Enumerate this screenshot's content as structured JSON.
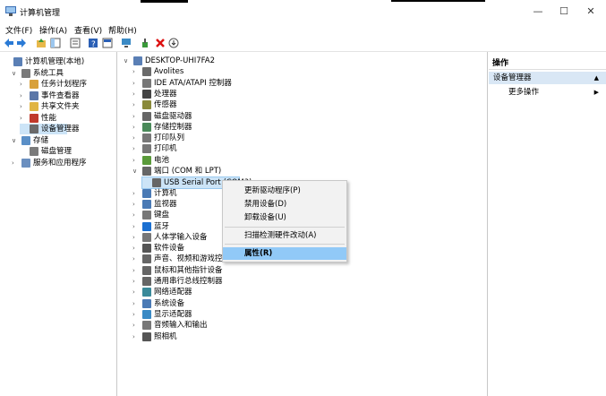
{
  "window": {
    "title": "计算机管理",
    "min": "—",
    "max": "☐",
    "close": "✕"
  },
  "menu": [
    "文件(F)",
    "操作(A)",
    "查看(V)",
    "帮助(H)"
  ],
  "left_tree": [
    {
      "label": "计算机管理(本地)",
      "arrow": "",
      "indent": 0,
      "icon_color": "#5a7fb5"
    },
    {
      "label": "系统工具",
      "arrow": "∨",
      "indent": 1,
      "icon_color": "#7a7a7a"
    },
    {
      "label": "任务计划程序",
      "arrow": "›",
      "indent": 2,
      "icon_color": "#d8a13b"
    },
    {
      "label": "事件查看器",
      "arrow": "›",
      "indent": 2,
      "icon_color": "#5b77a8"
    },
    {
      "label": "共享文件夹",
      "arrow": "›",
      "indent": 2,
      "icon_color": "#e0b443"
    },
    {
      "label": "性能",
      "arrow": "›",
      "indent": 2,
      "icon_color": "#c0392b"
    },
    {
      "label": "设备管理器",
      "arrow": "",
      "indent": 2,
      "icon_color": "#6a6a6a",
      "selected": true
    },
    {
      "label": "存储",
      "arrow": "∨",
      "indent": 1,
      "icon_color": "#5a8fc7"
    },
    {
      "label": "磁盘管理",
      "arrow": "",
      "indent": 2,
      "icon_color": "#7a7a7a"
    },
    {
      "label": "服务和应用程序",
      "arrow": "›",
      "indent": 1,
      "icon_color": "#6b8fbf"
    }
  ],
  "devices": [
    {
      "label": "DESKTOP-UHI7FA2",
      "arrow": "∨",
      "indent": 0,
      "icon_color": "#5a7fb5"
    },
    {
      "label": "Avolites",
      "arrow": "›",
      "indent": 1,
      "icon_color": "#6a6a6a"
    },
    {
      "label": "IDE ATA/ATAPI 控制器",
      "arrow": "›",
      "indent": 1,
      "icon_color": "#777777"
    },
    {
      "label": "处理器",
      "arrow": "›",
      "indent": 1,
      "icon_color": "#444444"
    },
    {
      "label": "传感器",
      "arrow": "›",
      "indent": 1,
      "icon_color": "#8a8a3a"
    },
    {
      "label": "磁盘驱动器",
      "arrow": "›",
      "indent": 1,
      "icon_color": "#666666"
    },
    {
      "label": "存储控制器",
      "arrow": "›",
      "indent": 1,
      "icon_color": "#4a8a5a"
    },
    {
      "label": "打印队列",
      "arrow": "›",
      "indent": 1,
      "icon_color": "#777777"
    },
    {
      "label": "打印机",
      "arrow": "›",
      "indent": 1,
      "icon_color": "#777777"
    },
    {
      "label": "电池",
      "arrow": "›",
      "indent": 1,
      "icon_color": "#5a9a3a"
    },
    {
      "label": "端口 (COM 和 LPT)",
      "arrow": "∨",
      "indent": 1,
      "icon_color": "#666666"
    },
    {
      "label": "USB Serial Port (COM3)",
      "arrow": "",
      "indent": 2,
      "icon_color": "#666666",
      "selected": true
    },
    {
      "label": "计算机",
      "arrow": "›",
      "indent": 1,
      "icon_color": "#4a7ab5"
    },
    {
      "label": "监视器",
      "arrow": "›",
      "indent": 1,
      "icon_color": "#4a7ab5"
    },
    {
      "label": "键盘",
      "arrow": "›",
      "indent": 1,
      "icon_color": "#777777"
    },
    {
      "label": "蓝牙",
      "arrow": "›",
      "indent": 1,
      "icon_color": "#1a6fd1"
    },
    {
      "label": "人体学输入设备",
      "arrow": "›",
      "indent": 1,
      "icon_color": "#777777"
    },
    {
      "label": "软件设备",
      "arrow": "›",
      "indent": 1,
      "icon_color": "#555555"
    },
    {
      "label": "声音、视频和游戏控制器",
      "arrow": "›",
      "indent": 1,
      "icon_color": "#666666"
    },
    {
      "label": "鼠标和其他指针设备",
      "arrow": "›",
      "indent": 1,
      "icon_color": "#666666"
    },
    {
      "label": "通用串行总线控制器",
      "arrow": "›",
      "indent": 1,
      "icon_color": "#666666"
    },
    {
      "label": "网络适配器",
      "arrow": "›",
      "indent": 1,
      "icon_color": "#3a8a9a"
    },
    {
      "label": "系统设备",
      "arrow": "›",
      "indent": 1,
      "icon_color": "#4a7ab5"
    },
    {
      "label": "显示适配器",
      "arrow": "›",
      "indent": 1,
      "icon_color": "#3a8ac5"
    },
    {
      "label": "音频输入和输出",
      "arrow": "›",
      "indent": 1,
      "icon_color": "#777777"
    },
    {
      "label": "照相机",
      "arrow": "›",
      "indent": 1,
      "icon_color": "#555555"
    }
  ],
  "context_menu": [
    "更新驱动程序(P)",
    "禁用设备(D)",
    "卸载设备(U)",
    "扫描检测硬件改动(A)",
    "属性(R)"
  ],
  "actions": {
    "header": "操作",
    "item": "设备管理器",
    "more": "更多操作",
    "up_arrow": "▲",
    "right_arrow": "▶"
  }
}
